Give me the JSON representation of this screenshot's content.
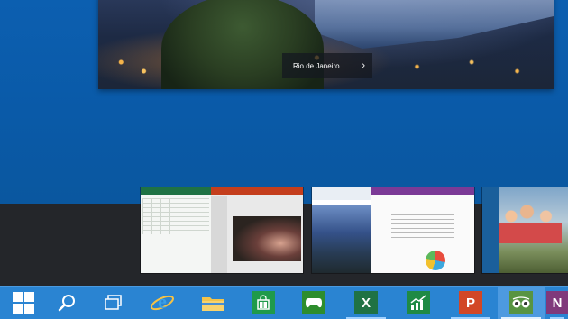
{
  "hero": {
    "caption": "Rio de Janeiro",
    "caption_arrow": "›"
  },
  "taskbar": {
    "items": [
      {
        "name": "start",
        "icon": "windows-logo-icon"
      },
      {
        "name": "search",
        "icon": "search-icon"
      },
      {
        "name": "task-view",
        "icon": "task-view-icon"
      },
      {
        "name": "internet-explorer",
        "icon": "internet-explorer-icon",
        "glyph": "e"
      },
      {
        "name": "file-explorer",
        "icon": "folder-icon"
      },
      {
        "name": "store",
        "icon": "store-icon"
      },
      {
        "name": "xbox-games",
        "icon": "game-controller-icon"
      },
      {
        "name": "excel",
        "icon": "excel-icon",
        "glyph": "X"
      },
      {
        "name": "finance",
        "icon": "finance-chart-icon"
      },
      {
        "name": "powerpoint",
        "icon": "powerpoint-icon",
        "glyph": "P"
      },
      {
        "name": "tripadvisor",
        "icon": "tripadvisor-owl-icon"
      },
      {
        "name": "onenote",
        "icon": "onenote-icon",
        "glyph": "N"
      }
    ]
  },
  "colors": {
    "taskbar": "#2a84d2",
    "desktop": "#0b5aa8",
    "excel": "#1f7244",
    "powerpoint": "#d24726",
    "store": "#1f9a4a",
    "xbox": "#2d8d2d",
    "finance": "#1f8a44",
    "tripadvisor": "#589442",
    "onenote": "#80397b"
  }
}
